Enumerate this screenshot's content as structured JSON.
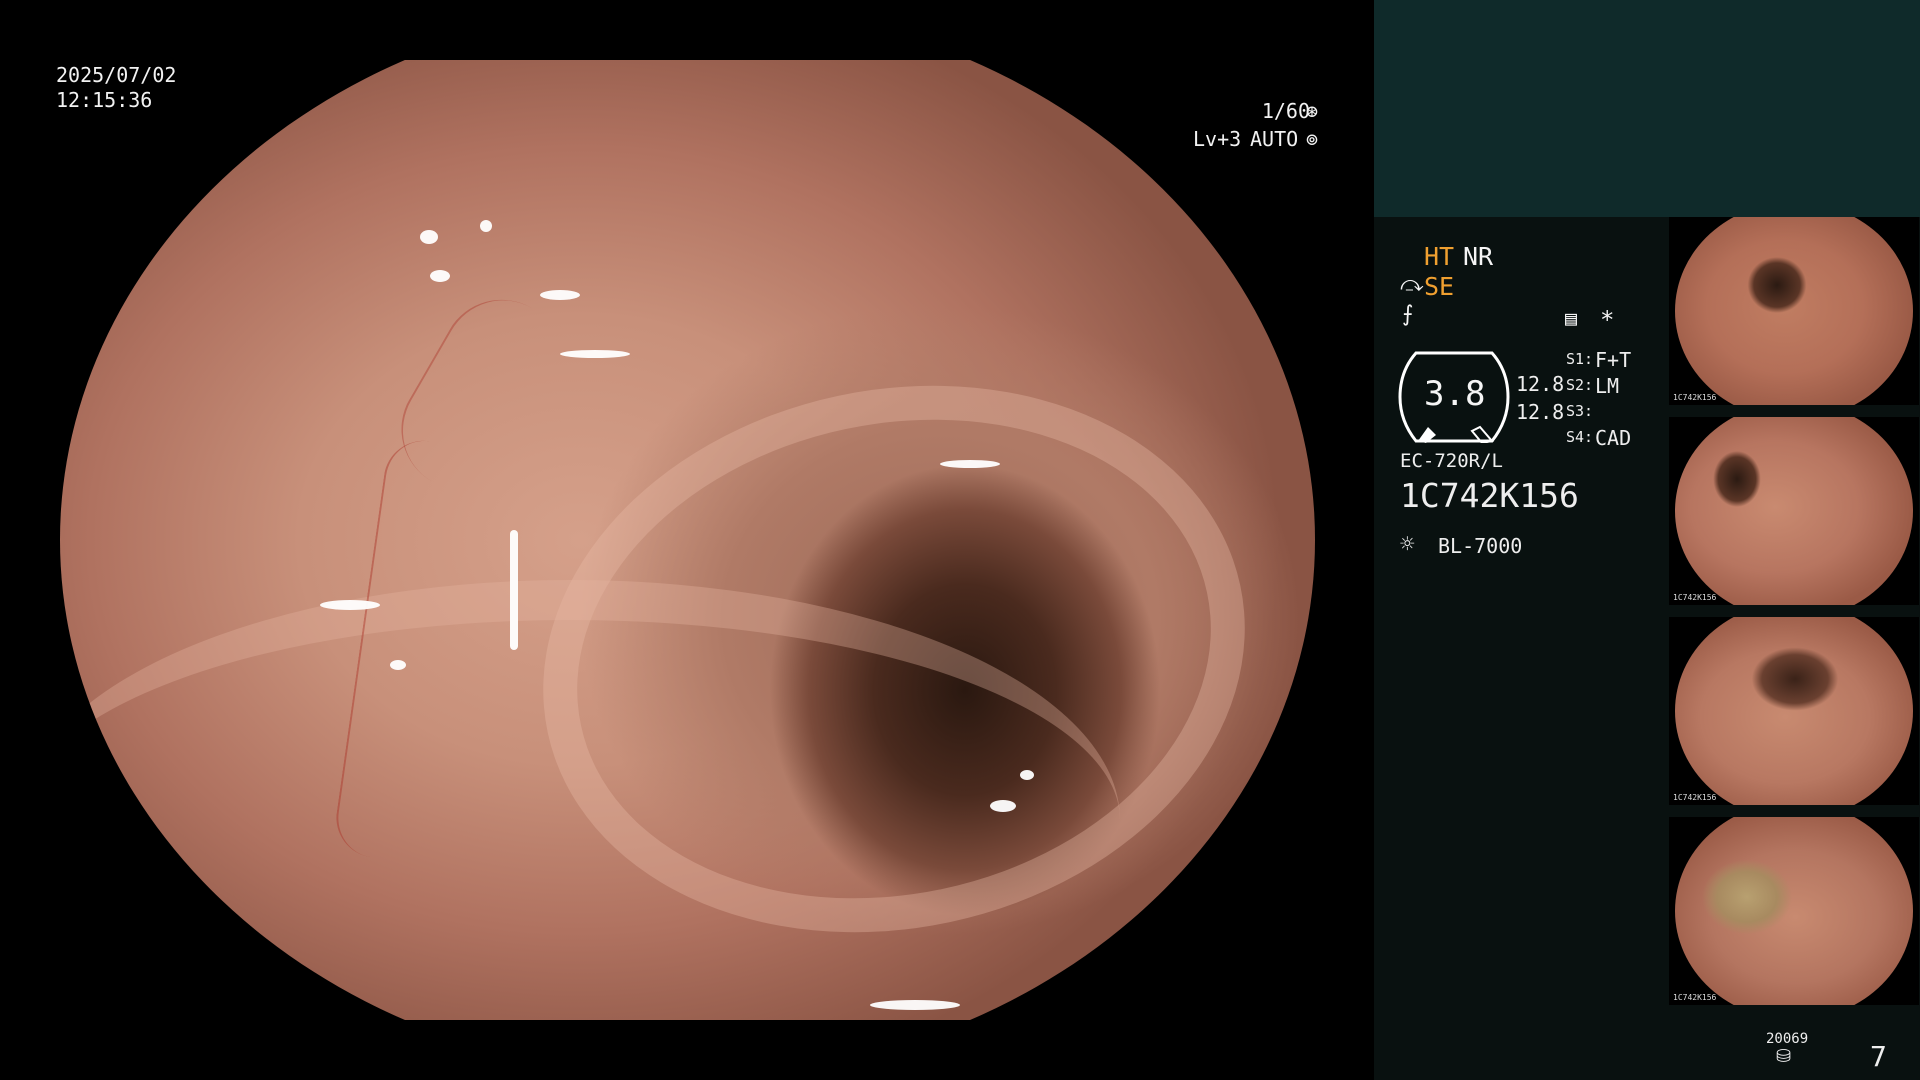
{
  "osd": {
    "date": "2025/07/02",
    "time": "12:15:36",
    "shutter": "1/60",
    "level": "Lv+3",
    "iris_mode": "AUTO"
  },
  "status": {
    "ht": "HT",
    "nr": "NR",
    "se": "SE",
    "star": "*"
  },
  "gauge": {
    "value": "3.8",
    "right_top": "12.8",
    "right_bottom": "12.8"
  },
  "switches": [
    {
      "label": "S1:",
      "value": "F+T"
    },
    {
      "label": "S2:",
      "value": "LM"
    },
    {
      "label": "S3:",
      "value": ""
    },
    {
      "label": "S4:",
      "value": "CAD"
    }
  ],
  "scope_model": "EC-720R/L",
  "scope_serial": "1C742K156",
  "light_source": "BL-7000",
  "thumbnails": [
    {
      "caption": "1C742K156"
    },
    {
      "caption": "1C742K156"
    },
    {
      "caption": "1C742K156"
    },
    {
      "caption": "1C742K156"
    }
  ],
  "footer": {
    "counter": "20069",
    "page": "7"
  },
  "icons": {
    "shutter": "aperture-icon",
    "iris": "iris-icon",
    "light": "lamp-icon",
    "settings": "menu-list-icon"
  }
}
